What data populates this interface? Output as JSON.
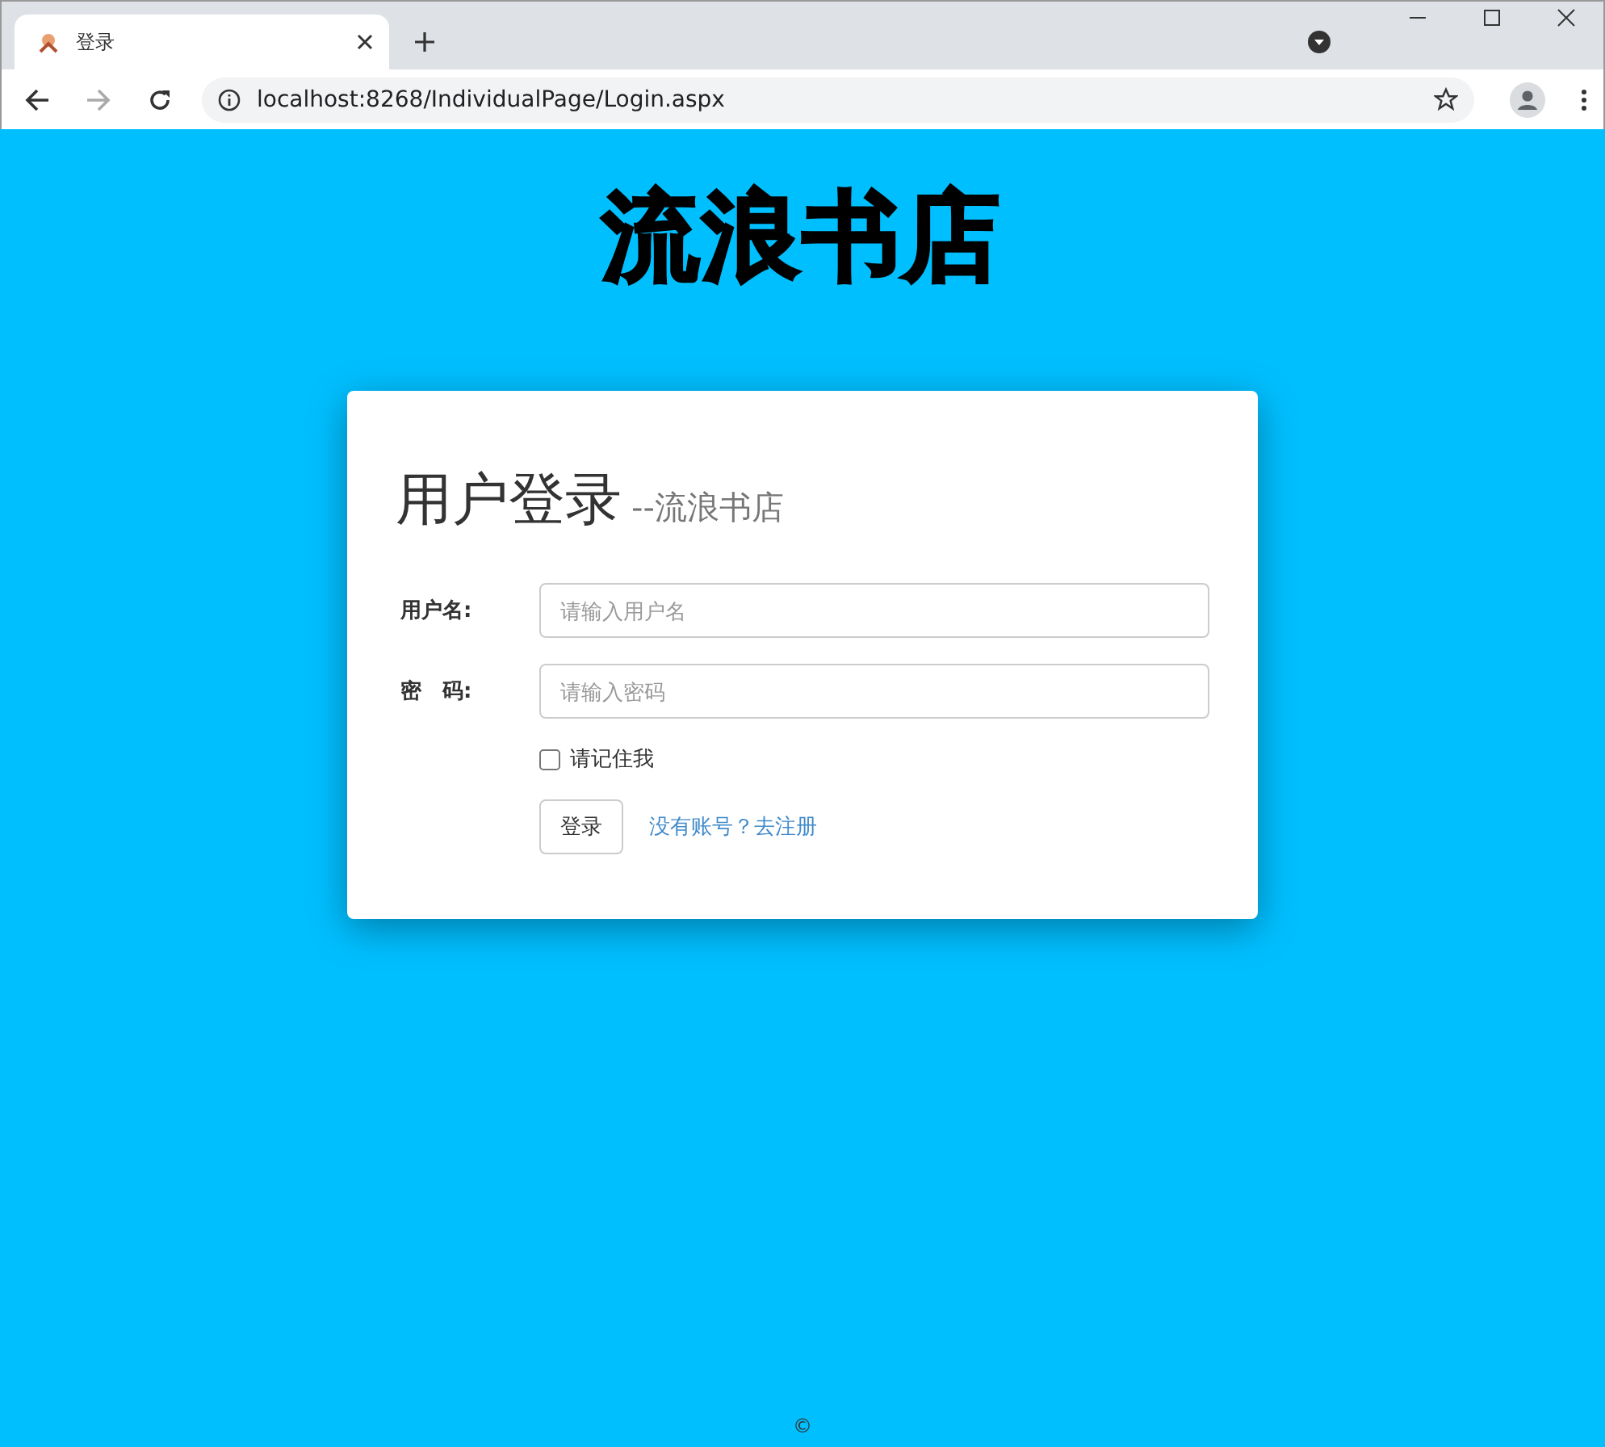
{
  "browser": {
    "tab_title": "登录",
    "url": "localhost:8268/IndividualPage/Login.aspx"
  },
  "logo": "流浪书店",
  "card": {
    "title": "用户登录",
    "subtitle": "--流浪书店",
    "fields": [
      {
        "label": "用户名:",
        "placeholder": "请输入用户名"
      },
      {
        "label": "密　码:",
        "placeholder": "请输入密码"
      }
    ],
    "remember": {
      "label": "请记住我",
      "checked": false
    },
    "button": "登录",
    "link": "没有账号？去注册"
  },
  "footer": "©"
}
